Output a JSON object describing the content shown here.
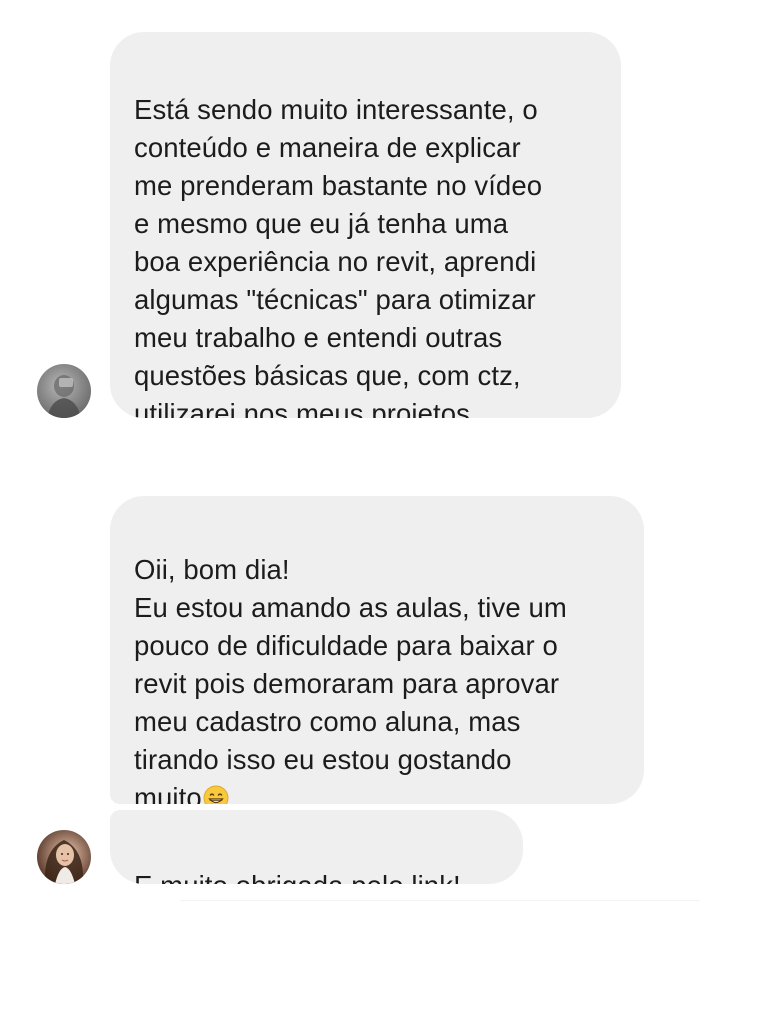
{
  "conversation": {
    "messages": [
      {
        "text": "Está sendo muito interessante, o\nconteúdo e maneira de explicar\nme prenderam bastante no vídeo\ne mesmo que eu já tenha uma\nboa experiência no revit, aprendi\nalgumas \"técnicas\" para otimizar\nmeu trabalho e entendi outras\nquestões básicas que, com ctz,\nutilizarei nos meus projetos",
        "emoji": ""
      },
      {
        "text": "Oii, bom dia!\nEu estou amando as aulas, tive um\npouco de dificuldade para baixar o\nrevit pois demoraram para aprovar\nmeu cadastro como aluna, mas\ntirando isso eu estou gostando\nmuito",
        "emoji": "grinning-face-emoji"
      },
      {
        "text": "E muito obrigada pelo link!",
        "emoji": ""
      }
    ]
  },
  "colors": {
    "bubble_background": "#efefef",
    "text": "#1c1c1c",
    "page_background": "#ffffff"
  }
}
